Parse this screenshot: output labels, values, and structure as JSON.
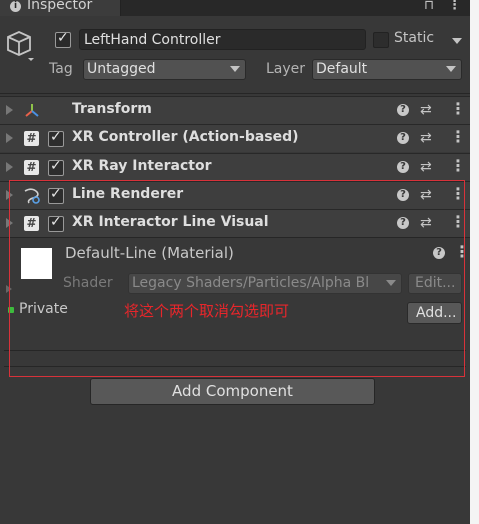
{
  "window": {
    "tab_title": "Inspector",
    "tab_icon": "info-icon"
  },
  "header": {
    "name": "LeftHand Controller",
    "active": true,
    "static_label": "Static",
    "static_checked": false,
    "tag_label": "Tag",
    "tag_value": "Untagged",
    "layer_label": "Layer",
    "layer_value": "Default"
  },
  "components": [
    {
      "name": "Transform",
      "icon": "transform-icon",
      "has_checkbox": false
    },
    {
      "name": "XR Controller (Action-based)",
      "icon": "script-icon",
      "has_checkbox": true,
      "checked": true
    },
    {
      "name": "XR Ray Interactor",
      "icon": "script-icon",
      "has_checkbox": true,
      "checked": true
    },
    {
      "name": "Line Renderer",
      "icon": "line-renderer-icon",
      "has_checkbox": true,
      "checked": true
    },
    {
      "name": "XR Interactor Line Visual",
      "icon": "script-icon",
      "has_checkbox": true,
      "checked": true
    }
  ],
  "material": {
    "name": "Default-Line (Material)",
    "shader_label": "Shader",
    "shader_value": "Legacy Shaders/Particles/Alpha Bl",
    "edit_label": "Edit..."
  },
  "private": {
    "label": "Private",
    "add_label": "Add..."
  },
  "annotation": {
    "text": "将这个两个取消勾选即可",
    "color": "#e8262b"
  },
  "footer": {
    "add_component_label": "Add Component"
  }
}
